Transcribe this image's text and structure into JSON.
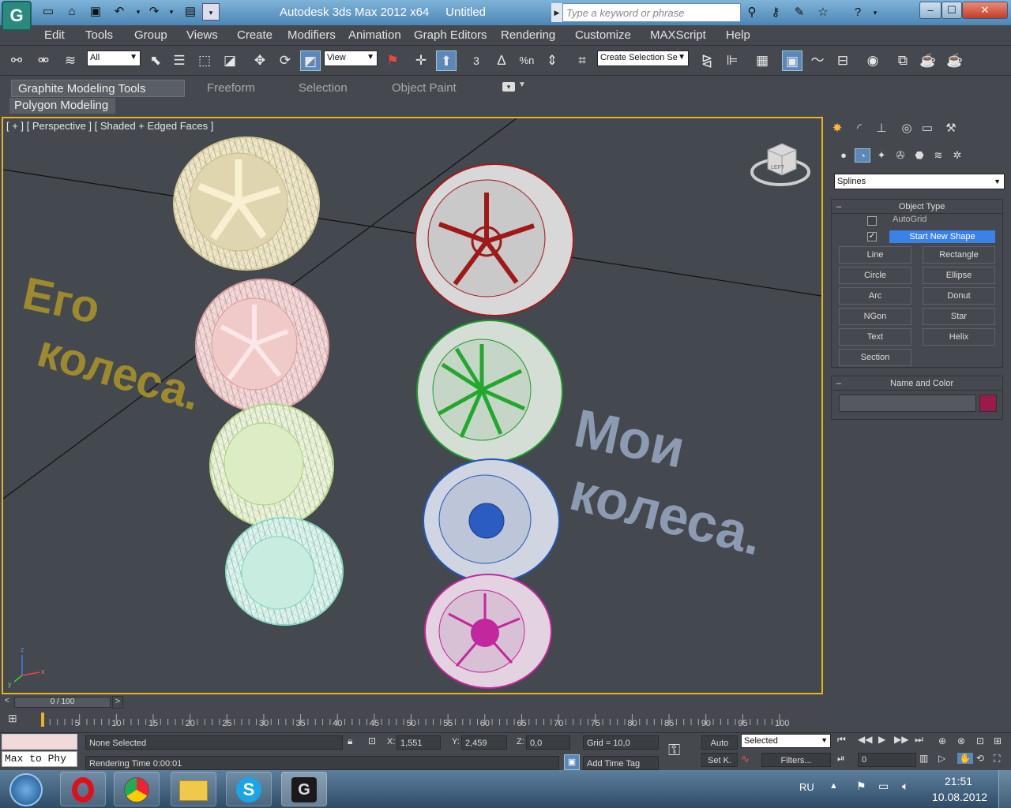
{
  "window": {
    "title": "Autodesk 3ds Max  2012 x64",
    "document": "Untitled",
    "search_placeholder": "Type a keyword or phrase",
    "min": "–",
    "max": "☐",
    "close": "✕"
  },
  "menu": [
    "Edit",
    "Tools",
    "Group",
    "Views",
    "Create",
    "Modifiers",
    "Animation",
    "Graph Editors",
    "Rendering",
    "Customize",
    "MAXScript",
    "Help"
  ],
  "toolbar": {
    "filter": "All",
    "coord": "View",
    "selection_set": "Create Selection Se",
    "snap3": "3",
    "snap_pct": "%n"
  },
  "ribbon": {
    "tabs": [
      "Graphite Modeling Tools",
      "Freeform",
      "Selection",
      "Object Paint"
    ],
    "sub": "Polygon Modeling"
  },
  "viewport": {
    "label": "[ + ] [ Perspective ] [ Shaded + Edged Faces ]",
    "text_left": [
      "Его",
      "колеса."
    ],
    "text_right": [
      "Мои",
      "колеса."
    ],
    "cube_label": "LEFT"
  },
  "panel": {
    "category": "Splines",
    "object_type": "Object Type",
    "autogrid": "AutoGrid",
    "start_new_shape": "Start New Shape",
    "buttons": [
      "Line",
      "Rectangle",
      "Circle",
      "Ellipse",
      "Arc",
      "Donut",
      "NGon",
      "Star",
      "Text",
      "Helix",
      "Section"
    ],
    "name_color": "Name and Color",
    "color": "#9a1a4a"
  },
  "time": {
    "frame": "0 / 100",
    "ticks": [
      "5",
      "10",
      "15",
      "20",
      "25",
      "30",
      "35",
      "40",
      "45",
      "50",
      "55",
      "60",
      "65",
      "70",
      "75",
      "80",
      "85",
      "90",
      "95",
      "100"
    ]
  },
  "status": {
    "listener": "Max to Phy",
    "selected": "None Selected",
    "render_time": "Rendering Time  0:00:01",
    "x_label": "X:",
    "x": "1,551",
    "y_label": "Y:",
    "y": "2,459",
    "z_label": "Z:",
    "z": "0,0",
    "grid": "Grid = 10,0",
    "add_time_tag": "Add Time Tag",
    "auto": "Auto",
    "set_k": "Set K.",
    "selected_mode": "Selected",
    "filters": "Filters...",
    "frame_field": "0"
  },
  "taskbar": {
    "lang": "RU",
    "time": "21:51",
    "date": "10.08.2012"
  }
}
